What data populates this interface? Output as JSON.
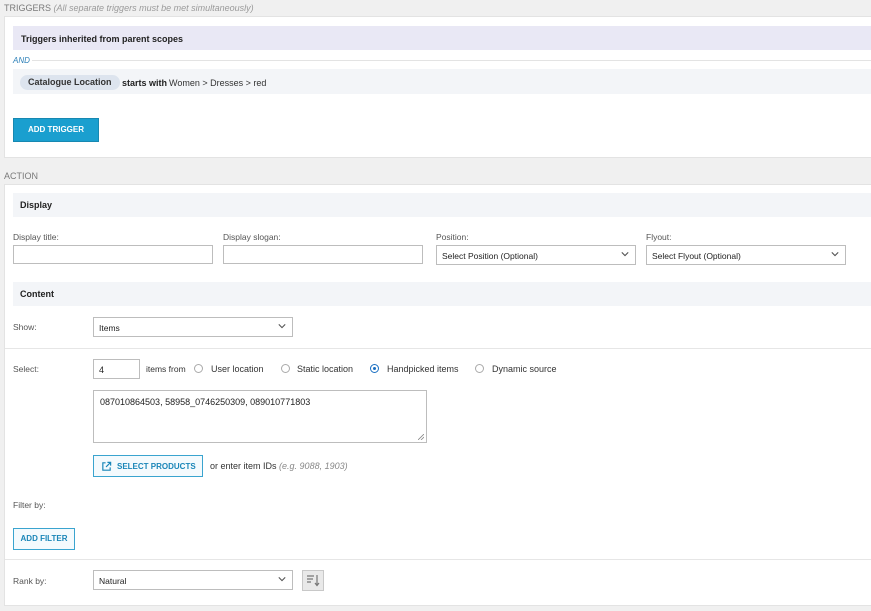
{
  "triggers": {
    "title": "TRIGGERS",
    "subtitle": "(All separate triggers must be met simultaneously)",
    "inherited_label": "Triggers inherited from parent scopes",
    "and_label": "AND",
    "condition": {
      "field": "Catalogue Location",
      "operator": "starts with",
      "value": "Women > Dresses > red"
    },
    "add_button": "ADD TRIGGER"
  },
  "action": {
    "title": "ACTION",
    "display": {
      "heading": "Display",
      "title_label": "Display title:",
      "title_value": "",
      "slogan_label": "Display slogan:",
      "slogan_value": "",
      "position_label": "Position:",
      "position_value": "Select Position (Optional)",
      "flyout_label": "Flyout:",
      "flyout_value": "Select Flyout (Optional)"
    },
    "content": {
      "heading": "Content",
      "show_label": "Show:",
      "show_value": "Items",
      "select_label": "Select:",
      "select_count": "4",
      "items_from": "items from",
      "sources": [
        {
          "label": "User location",
          "selected": false
        },
        {
          "label": "Static location",
          "selected": false
        },
        {
          "label": "Handpicked items",
          "selected": true
        },
        {
          "label": "Dynamic source",
          "selected": false
        }
      ],
      "item_ids": "087010864503, 58958_0746250309, 089010771803",
      "select_products_button": "SELECT PRODUCTS",
      "or_enter": "or enter item IDs",
      "ids_example": "(e.g. 9088, 1903)",
      "filter_label": "Filter by:",
      "add_filter_button": "ADD FILTER",
      "rank_label": "Rank by:",
      "rank_value": "Natural"
    }
  },
  "colors": {
    "accent": "#1a9fcf",
    "inherited_bg": "#e9e8f5",
    "section_bg": "#f3f5f8",
    "link_blue": "#2b7fb8"
  }
}
